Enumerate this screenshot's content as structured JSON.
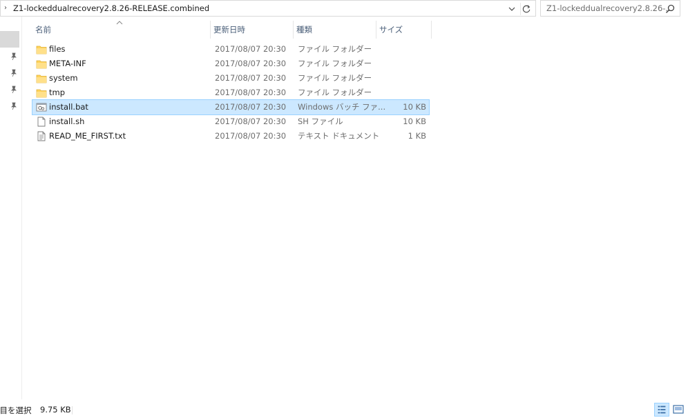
{
  "address_bar": {
    "path": "Z1-lockeddualrecovery2.8.26-RELEASE.combined"
  },
  "search": {
    "placeholder": "Z1-lockeddualrecovery2.8.26-..."
  },
  "columns": {
    "name": "名前",
    "date": "更新日時",
    "type": "種類",
    "size": "サイズ"
  },
  "files": [
    {
      "name": "files",
      "date": "2017/08/07 20:30",
      "type": "ファイル フォルダー",
      "size": "",
      "icon": "folder-icon"
    },
    {
      "name": "META-INF",
      "date": "2017/08/07 20:30",
      "type": "ファイル フォルダー",
      "size": "",
      "icon": "folder-icon"
    },
    {
      "name": "system",
      "date": "2017/08/07 20:30",
      "type": "ファイル フォルダー",
      "size": "",
      "icon": "folder-icon"
    },
    {
      "name": "tmp",
      "date": "2017/08/07 20:30",
      "type": "ファイル フォルダー",
      "size": "",
      "icon": "folder-icon"
    },
    {
      "name": "install.bat",
      "date": "2017/08/07 20:30",
      "type": "Windows バッチ ファ...",
      "size": "10 KB",
      "icon": "batch-file-icon",
      "selected": true
    },
    {
      "name": "install.sh",
      "date": "2017/08/07 20:30",
      "type": "SH ファイル",
      "size": "10 KB",
      "icon": "file-icon"
    },
    {
      "name": "READ_ME_FIRST.txt",
      "date": "2017/08/07 20:30",
      "type": "テキスト ドキュメント",
      "size": "1 KB",
      "icon": "text-file-icon"
    }
  ],
  "status_bar": {
    "selected_items": "項目を選択",
    "selected_size": "9.75 KB"
  },
  "colors": {
    "selection_bg": "#cce8ff",
    "selection_border": "#99d1ff",
    "folder": "#ffd35b",
    "header_text": "#4c607a"
  }
}
